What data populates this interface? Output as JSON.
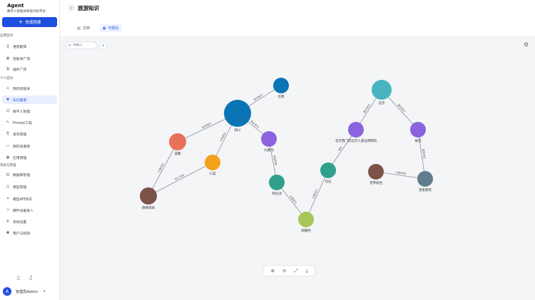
{
  "brand": {
    "title": "Agent",
    "subtitle": "数字人智能体和低代码平台"
  },
  "cta": {
    "label": "快速搭建"
  },
  "sidebar": {
    "sections": [
      {
        "label": "应用空间",
        "items": [
          {
            "label": "语音翻译",
            "icon": "translate-icon"
          },
          {
            "label": "智能体广场",
            "icon": "grid-icon"
          },
          {
            "label": "插件广场",
            "icon": "plugin-icon"
          }
        ]
      },
      {
        "label": "个人空间",
        "items": [
          {
            "label": "我的智能体",
            "icon": "user-icon"
          },
          {
            "label": "知识图谱",
            "icon": "filter-icon",
            "active": true
          },
          {
            "label": "数字人管理",
            "icon": "person-icon"
          },
          {
            "label": "Prompt工程",
            "icon": "edit-icon"
          },
          {
            "label": "发布管理",
            "icon": "publish-icon"
          },
          {
            "label": "我的资源库",
            "icon": "folder-icon"
          },
          {
            "label": "应用管理",
            "icon": "app-icon"
          }
        ]
      },
      {
        "label": "系统与管理",
        "items": [
          {
            "label": "数据库管理",
            "icon": "database-icon"
          },
          {
            "label": "模型管理",
            "icon": "model-icon"
          },
          {
            "label": "模型API测试",
            "icon": "api-icon"
          },
          {
            "label": "硬件设备接入",
            "icon": "device-icon"
          },
          {
            "label": "系统设置",
            "icon": "gear-icon"
          },
          {
            "label": "用户与权限",
            "icon": "users-icon"
          }
        ]
      }
    ]
  },
  "user": {
    "initial": "A",
    "name": "管理员Admin"
  },
  "header": {
    "back": "‹",
    "title": "旅游知识",
    "tabs": [
      {
        "label": "文档"
      },
      {
        "label": "可视化",
        "active": true
      }
    ]
  },
  "search": {
    "placeholder": "请输入"
  },
  "graph": {
    "nodes": [
      {
        "label": "四川",
        "color": "#0b74b5"
      },
      {
        "label": "云南",
        "color": "#0b74b5"
      },
      {
        "label": "成都",
        "color": "#e8715a"
      },
      {
        "label": "川菜",
        "color": "#f5a11b"
      },
      {
        "label": "麻辣风味",
        "color": "#7b5348"
      },
      {
        "label": "九寨沟",
        "color": "#8b63e0"
      },
      {
        "label": "钙化池",
        "color": "#2fa08e"
      },
      {
        "label": "碳酸钙",
        "color": "#a8c75a"
      },
      {
        "label": "化石",
        "color": "#2fa08e"
      },
      {
        "label": "北京西门店北京人遗址博物馆",
        "color": "#8b63e0"
      },
      {
        "label": "北京",
        "color": "#49b4c0"
      },
      {
        "label": "故宫",
        "color": "#8b63e0"
      },
      {
        "label": "皇帝居住",
        "color": "#7b5348"
      },
      {
        "label": "皇家建筑",
        "color": "#5f7d8c"
      }
    ],
    "edges": [
      {
        "label": "相邻省份"
      },
      {
        "label": "省会城市"
      },
      {
        "label": "代表菜系"
      },
      {
        "label": "主要菜系"
      },
      {
        "label": "核心风味"
      },
      {
        "label": "著名景点"
      },
      {
        "label": "典型地貌"
      },
      {
        "label": "主要成分"
      },
      {
        "label": "主要成分"
      },
      {
        "label": "保存"
      },
      {
        "label": "著名景点"
      },
      {
        "label": "著名景点"
      },
      {
        "label": "建筑特征"
      },
      {
        "label": "功能用途"
      }
    ]
  },
  "zoom": {
    "icons": [
      "zoom-in-icon",
      "zoom-out-icon",
      "fit-icon",
      "download-icon"
    ]
  }
}
